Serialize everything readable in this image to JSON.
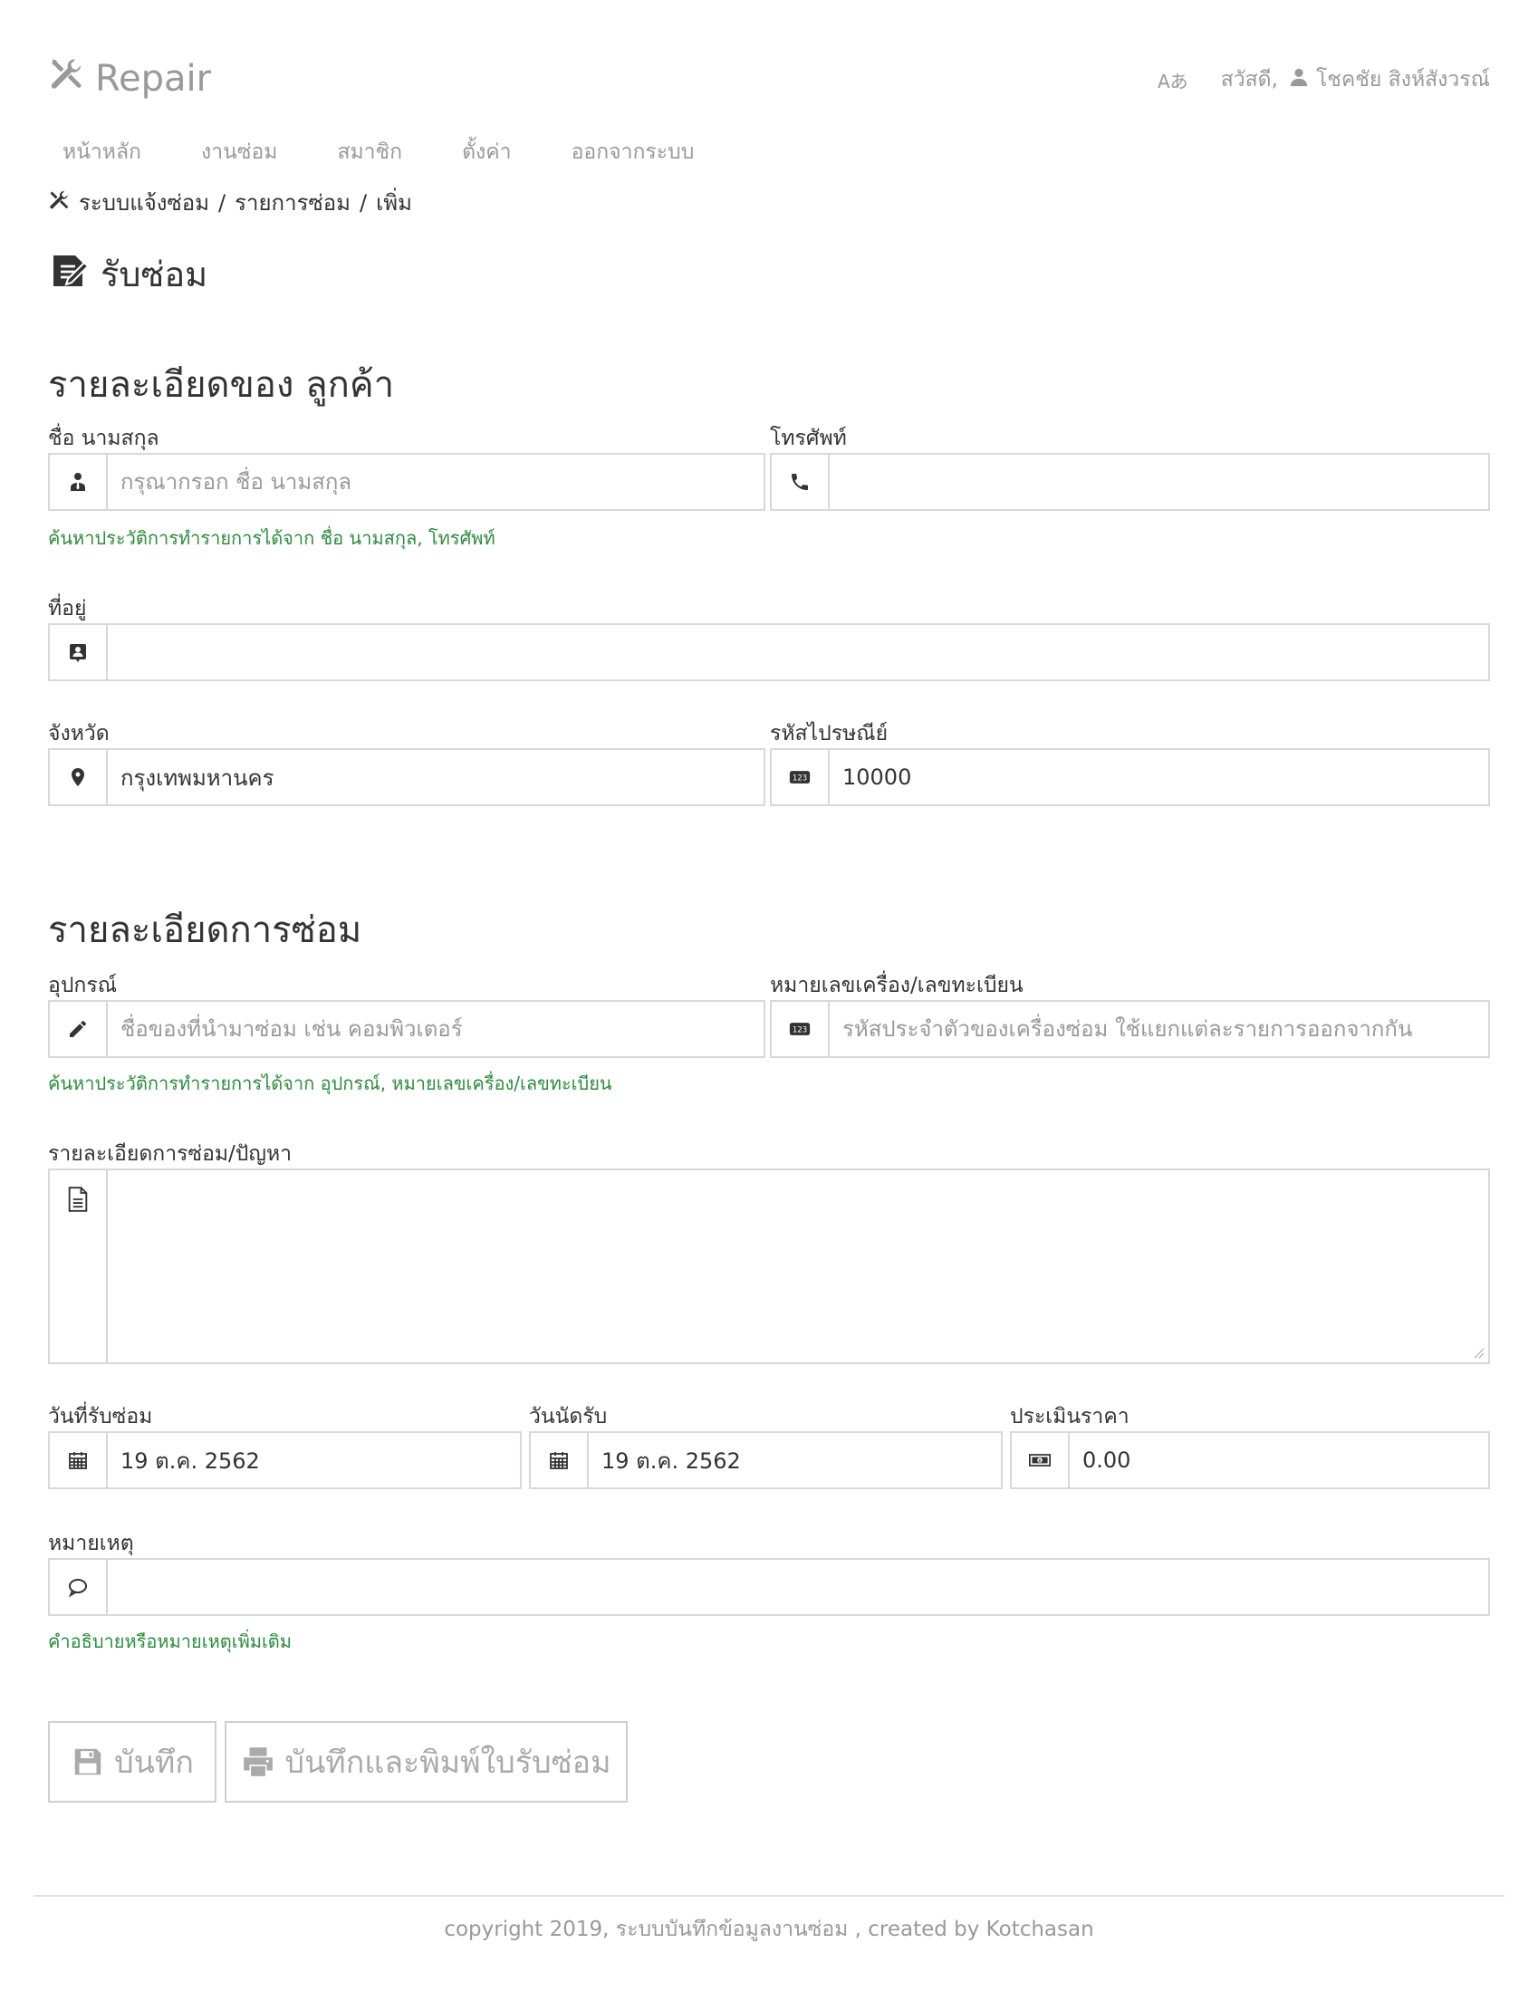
{
  "app": {
    "title": "Repair"
  },
  "userbar": {
    "lang_label": "Aあ",
    "greeting": "สวัสดี,",
    "username": "โชคชัย สิงห์สังวรณ์"
  },
  "nav": {
    "items": [
      "หน้าหลัก",
      "งานซ่อม",
      "สมาชิก",
      "ตั้งค่า",
      "ออกจากระบบ"
    ]
  },
  "breadcrumb": {
    "items": [
      "ระบบแจ้งซ่อม",
      "รายการซ่อม",
      "เพิ่ม"
    ],
    "separator": "/"
  },
  "page": {
    "title": "รับซ่อม"
  },
  "customer": {
    "section_title": "รายละเอียดของ ลูกค้า",
    "name": {
      "label": "ชื่อ นามสกุล",
      "placeholder": "กรุณากรอก ชื่อ นามสกุล",
      "value": ""
    },
    "phone": {
      "label": "โทรศัพท์",
      "placeholder": "",
      "value": ""
    },
    "search_hint": "ค้นหาประวัติการทำรายการได้จาก ชื่อ นามสกุล, โทรศัพท์",
    "address": {
      "label": "ที่อยู่",
      "value": ""
    },
    "province": {
      "label": "จังหวัด",
      "value": "กรุงเทพมหานคร"
    },
    "zipcode": {
      "label": "รหัสไปรษณีย์",
      "value": "10000"
    }
  },
  "repair": {
    "section_title": "รายละเอียดการซ่อม",
    "equipment": {
      "label": "อุปกรณ์",
      "placeholder": "ชื่อของที่นำมาซ่อม เช่น คอมพิวเตอร์",
      "value": ""
    },
    "serial": {
      "label": "หมายเลขเครื่อง/เลขทะเบียน",
      "placeholder": "รหัสประจำตัวของเครื่องซ่อม ใช้แยกแต่ละรายการออกจากกัน",
      "value": ""
    },
    "search_hint": "ค้นหาประวัติการทำรายการได้จาก อุปกรณ์, หมายเลขเครื่อง/เลขทะเบียน",
    "detail": {
      "label": "รายละเอียดการซ่อม/ปัญหา",
      "value": ""
    },
    "received_date": {
      "label": "วันที่รับซ่อม",
      "value": "19 ต.ค. 2562"
    },
    "appointment_date": {
      "label": "วันนัดรับ",
      "value": "19 ต.ค. 2562"
    },
    "estimate": {
      "label": "ประเมินราคา",
      "value": "0.00"
    },
    "note": {
      "label": "หมายเหตุ",
      "value": ""
    },
    "note_hint": "คำอธิบายหรือหมายเหตุเพิ่มเติม"
  },
  "actions": {
    "save_label": "บันทึก",
    "save_print_label": "บันทึกและพิมพ์ใบรับซ่อม"
  },
  "footer": {
    "text": "copyright 2019, ระบบบันทึกข้อมูลงานซ่อม , created by Kotchasan"
  },
  "colors": {
    "hint_green": "#2e8b3e",
    "muted": "#999999",
    "border": "#d8d8d8"
  }
}
